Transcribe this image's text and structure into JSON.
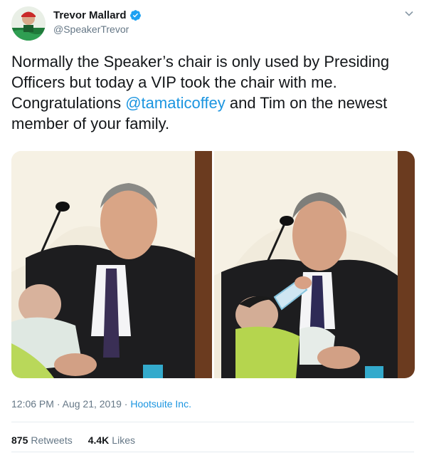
{
  "author": {
    "display_name": "Trevor Mallard",
    "handle": "@SpeakerTrevor"
  },
  "tweet": {
    "text_part1": "Normally the Speaker’s chair is only used by Presiding Officers but today a VIP took the chair with me. Congratulations ",
    "mention": "@tamaticoffey",
    "text_part2": " and Tim on the newest member of your family."
  },
  "meta": {
    "time": "12:06 PM",
    "separator1": " · ",
    "date": "Aug 21, 2019",
    "separator2": " · ",
    "source_app": "Hootsuite Inc."
  },
  "stats": {
    "retweets_count": "875",
    "retweets_label": "Retweets",
    "likes_count": "4.4K",
    "likes_label": "Likes"
  },
  "icons": {
    "verified": "verified-badge-icon",
    "caret": "chevron-down-icon"
  },
  "colors": {
    "link": "#1b95e0",
    "secondary_text": "#657786",
    "primary_text": "#14171a",
    "verified": "#1da1f2"
  }
}
